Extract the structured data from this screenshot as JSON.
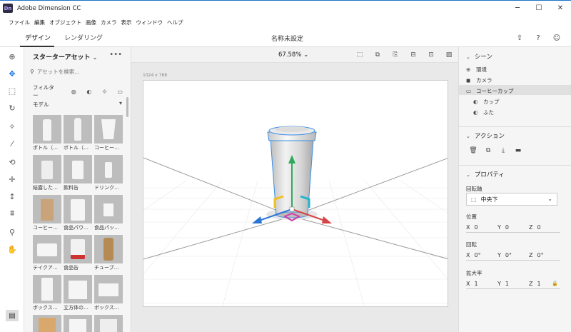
{
  "window": {
    "badge": "Dn",
    "title": "Adobe Dimension CC",
    "minimize": "─",
    "maximize": "☐",
    "close": "✕"
  },
  "menu": [
    "ファイル",
    "編集",
    "オブジェクト",
    "画像",
    "カメラ",
    "表示",
    "ウィンドウ",
    "ヘルプ"
  ],
  "modes": {
    "design": "デザイン",
    "render": "レンダリング"
  },
  "document_title": "名称未設定",
  "top_icons": [
    "share-icon",
    "help-icon",
    "community-icon"
  ],
  "tools": [
    "add-icon",
    "select-icon",
    "magic-select-icon",
    "orbit-icon",
    "magic-wand-icon",
    "sample-icon",
    "pan-orbit-icon",
    "move-icon",
    "align-icon",
    "drop-icon",
    "zoom-icon",
    "hand-icon"
  ],
  "assets": {
    "title": "スターターアセット",
    "search_placeholder": "アセットを検索...",
    "filter_label": "フィルター",
    "section": "モデル",
    "items": [
      "ボトル（…",
      "ボトル（…",
      "コーヒー…",
      "結露した…",
      "飲料缶",
      "ドリンク…",
      "コーヒー…",
      "食品パウ…",
      "食品パッ…",
      "テイクア…",
      "食品缶",
      "チューブ…",
      "ボックス…",
      "立方体の…",
      "ボックス…"
    ]
  },
  "viewport": {
    "zoom": "67.58%",
    "canvas_size": "1024 x 768"
  },
  "scene": {
    "title": "シーン",
    "items": [
      {
        "label": "環境",
        "icon": "globe-icon"
      },
      {
        "label": "カメラ",
        "icon": "camera-icon"
      },
      {
        "label": "コーヒーカップ",
        "icon": "folder-icon"
      },
      {
        "label": "カップ",
        "icon": "material-icon"
      },
      {
        "label": "ふた",
        "icon": "material-icon"
      }
    ]
  },
  "actions": {
    "title": "アクション",
    "icons": [
      "delete-icon",
      "group-icon",
      "export-icon",
      "folder-icon"
    ]
  },
  "properties": {
    "title": "プロパティ",
    "pivot_label": "回転軸",
    "pivot_value": "中央下",
    "position_label": "位置",
    "position": {
      "x": "0",
      "y": "0",
      "z": "0"
    },
    "rotation_label": "回転",
    "rotation": {
      "x": "0°",
      "y": "0°",
      "z": "0°"
    },
    "scale_label": "拡大率",
    "scale": {
      "x": "1",
      "y": "1",
      "z": "1"
    }
  }
}
